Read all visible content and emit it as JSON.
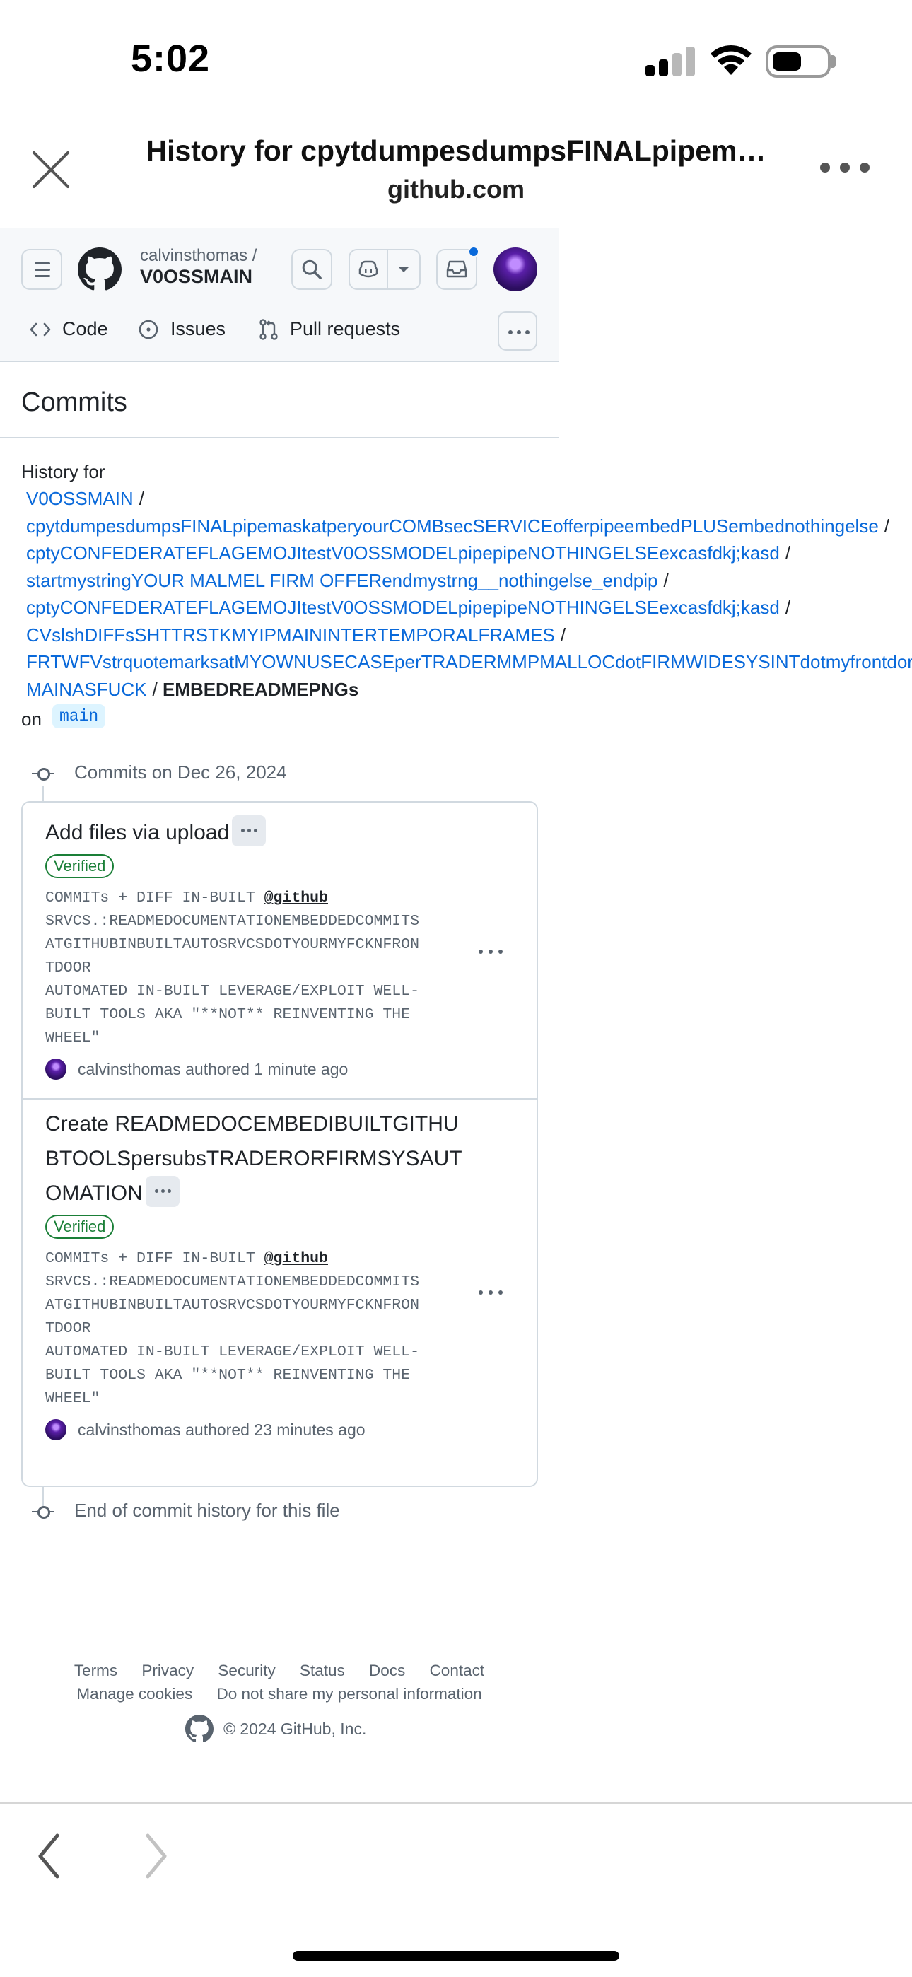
{
  "status_bar": {
    "time": "5:02"
  },
  "browser": {
    "title": "History for cpytdumpesdumpsFINALpipem…",
    "domain": "github.com"
  },
  "header": {
    "owner": "calvinsthomas /",
    "repo": "V0OSSMAIN",
    "nav": [
      {
        "label": "Code",
        "icon": "code-icon"
      },
      {
        "label": "Issues",
        "icon": "issue-opened-icon"
      },
      {
        "label": "Pull requests",
        "icon": "git-pull-request-icon"
      }
    ]
  },
  "page": {
    "heading": "Commits",
    "history_for": "History for",
    "path": [
      "V0OSSMAIN",
      "cpytdumpesdumpsFINALpipemaskatperyourCOMBsecSERVICEofferpipeembedPLUSembednothingelse",
      "cptyCONFEDERATEFLAGEMOJItestV0OSSMODELpipepipeNOTHINGELSEexcasfdkj;kasd",
      "startmystringYOUR MALMEL FIRM OFFERendmystrng__nothingelse_endpip",
      "cptyCONFEDERATEFLAGEMOJItestV0OSSMODELpipepipeNOTHINGELSEexcasfdkj;kasd",
      "CVslshDIFFsSHTTRSTKMYIPMAININTERTEMPORALFRAMES",
      "FRTWFVstrquotemarksatMYOWNUSECASEperTRADERMMPMALLOCdotFIRMWIDESYSINTdotmyfrontdor",
      "MAINASFUCK"
    ],
    "path_current": "EMBEDREADMEPNGs",
    "separator": "/",
    "on_label": "on",
    "branch": "main",
    "group_label": "Commits on Dec 26, 2024",
    "end_label": "End of commit history for this file"
  },
  "commits": [
    {
      "title": "Add files via upload",
      "verified": "Verified",
      "msg_prefix": "COMMITs + DIFF IN-BUILT ",
      "mention": "@github",
      "msg_rest": "SRVCS.:READMEDOCUMENTATIONEMBEDDEDCOMMITS\nATGITHUBINBUILTAUTOSRVCSDOTYOURMYFCKNFRON\nTDOOR\nAUTOMATED IN-BUILT LEVERAGE/EXPLOIT WELL-\nBUILT TOOLS AKA \"**NOT** REINVENTING THE\nWHEEL\"",
      "author": "calvinsthomas authored 1 minute ago"
    },
    {
      "title": "Create READMEDOCEMBEDIBUILTGITHUBTOOLSpersubsTRADERORFIRMSYSAUTOMATION",
      "verified": "Verified",
      "msg_prefix": "COMMITs + DIFF IN-BUILT ",
      "mention": "@github",
      "msg_rest": "SRVCS.:READMEDOCUMENTATIONEMBEDDEDCOMMITS\nATGITHUBINBUILTAUTOSRVCSDOTYOURMYFCKNFRON\nTDOOR\nAUTOMATED IN-BUILT LEVERAGE/EXPLOIT WELL-\nBUILT TOOLS AKA \"**NOT** REINVENTING THE\nWHEEL\"",
      "author": "calvinsthomas authored 23 minutes ago"
    }
  ],
  "footer": {
    "links_row1": [
      "Terms",
      "Privacy",
      "Security",
      "Status",
      "Docs",
      "Contact"
    ],
    "links_row2": [
      "Manage cookies",
      "Do not share my personal information"
    ],
    "copyright": "© 2024 GitHub, Inc."
  },
  "colors": {
    "link": "#0969da",
    "verified": "#1a7f37",
    "muted": "#59636e",
    "border": "#d1d9e0"
  }
}
